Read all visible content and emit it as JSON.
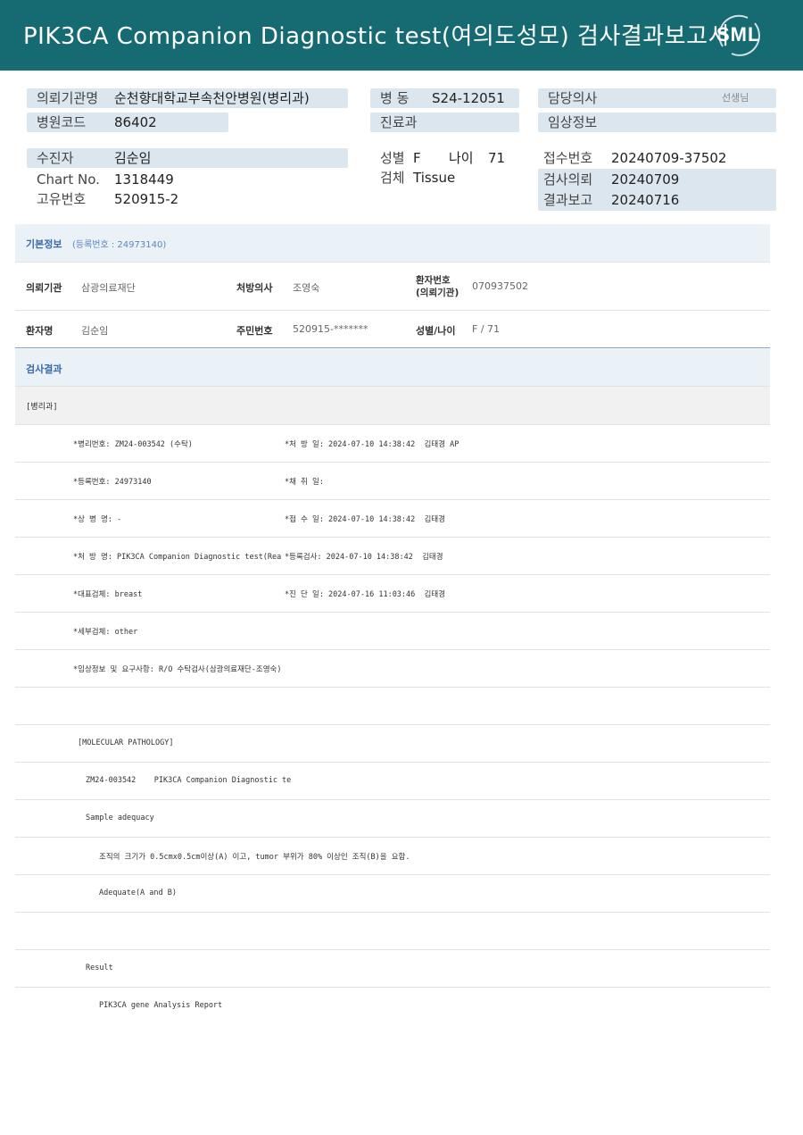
{
  "header": {
    "title": "PIK3CA  Companion  Diagnostic  test(여의도성모) 검사결과보고서",
    "logo": "SML"
  },
  "summary": {
    "institution_label": "의뢰기관명",
    "institution": "순천향대학교부속천안병원(병리과)",
    "hospital_code_label": "병원코드",
    "hospital_code": "86402",
    "ward_label": "병  동",
    "ward": "S24-12051",
    "dept_label": "진료과",
    "dept": "",
    "doctor_label": "담당의사",
    "doctor_suffix": "선생님",
    "clinical_label": "임상정보",
    "clinical": "",
    "patient_label": "수진자",
    "patient": "김순임",
    "chart_label": "Chart No.",
    "chart": "1318449",
    "unique_label": "고유번호",
    "unique": "520915-2",
    "sex_label": "성별",
    "sex": "F",
    "age_label": "나이",
    "age": "71",
    "specimen_label": "검체",
    "specimen": "Tissue",
    "receipt_label": "접수번호",
    "receipt": "20240709-37502",
    "request_label": "검사의뢰",
    "request": "20240709",
    "result_label": "결과보고",
    "result": "20240716"
  },
  "basic": {
    "heading": "기본정보",
    "reg_note": "(등록번호 : 24973140)",
    "inst_label": "의뢰기관",
    "inst": "삼광의료재단",
    "presc_label": "처방의사",
    "presc": "조영숙",
    "pid_label_1": "환자번호",
    "pid_label_2": "(의뢰기관)",
    "pid": "070937502",
    "name_label": "환자명",
    "name": "김순임",
    "rrn_label": "주민번호",
    "rrn": "520915-*******",
    "sexage_label": "성별/나이",
    "sexage": "F / 71"
  },
  "results": {
    "heading": "검사결과",
    "sub_heading": "[병리과]",
    "lines": [
      {
        "left": "*병리번호: ZM24-003542 (수탁)",
        "right": "*처 방 일: 2024-07-10 14:38:42  김태경 AP"
      },
      {
        "left": "*등록번호: 24973140",
        "right": "*채 취 일:"
      },
      {
        "left": "*상 병 명: -",
        "right": "*접 수 일: 2024-07-10 14:38:42  김태경"
      },
      {
        "left": "*처 방 명: PIK3CA Companion Diagnostic test(Rea",
        "right": "*등록검사: 2024-07-10 14:38:42  김태경"
      },
      {
        "left": "*대표검체: breast",
        "right": "*진 단 일: 2024-07-16 11:03:46  김태경"
      },
      {
        "left": "*세부검체: other",
        "right": ""
      },
      {
        "left": "*임상정보 및 요구사항: R/O 수탁검사(삼광의료재단-조영숙)",
        "right": ""
      }
    ],
    "molecular_heading": "[MOLECULAR PATHOLOGY]",
    "mp_id": "ZM24-003542    PIK3CA Companion Diagnostic te",
    "sample_adequacy": "Sample adequacy",
    "adequacy_note": "조직의 크기가 0.5cmx0.5cm이상(A) 이고, tumor 부위가 80% 이상인 조직(B)을 요함.",
    "adequate": "Adequate(A and B)",
    "result_heading": "Result",
    "report_title": "PIK3CA gene Analysis Report"
  }
}
